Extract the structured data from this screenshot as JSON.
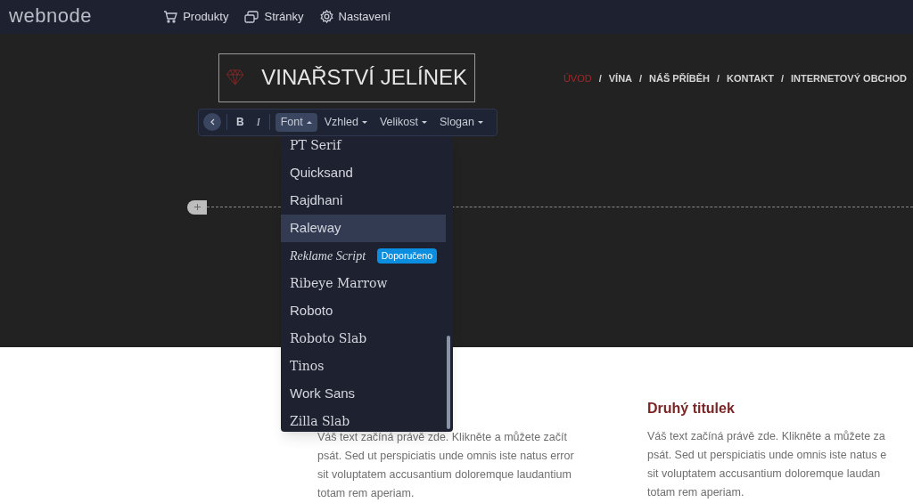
{
  "topbar": {
    "logo": "webnode",
    "menu": [
      {
        "label": "Produkty"
      },
      {
        "label": "Stránky"
      },
      {
        "label": "Nastavení"
      }
    ]
  },
  "site": {
    "logo_text": "VINAŘSTVÍ JELÍNEK",
    "nav": [
      {
        "label": "ÚVOD",
        "selected": true
      },
      {
        "label": "VÍNA",
        "selected": false
      },
      {
        "label": "NÁŠ PŘÍBĚH",
        "selected": false
      },
      {
        "label": "KONTAKT",
        "selected": false
      },
      {
        "label": "INTERNETOVÝ OBCHOD",
        "selected": false
      }
    ],
    "separator": "/"
  },
  "toolbar": {
    "bold": "B",
    "italic": "I",
    "menus": [
      {
        "label": "Font",
        "expanded": true
      },
      {
        "label": "Vzhled",
        "expanded": false
      },
      {
        "label": "Velikost",
        "expanded": false
      },
      {
        "label": "Slogan",
        "expanded": false
      }
    ]
  },
  "font_dropdown": {
    "items": [
      {
        "label": "PT Serif",
        "selected": false
      },
      {
        "label": "Quicksand",
        "selected": false
      },
      {
        "label": "Rajdhani",
        "selected": false
      },
      {
        "label": "Raleway",
        "selected": true
      },
      {
        "label": "Reklame Script",
        "selected": false,
        "badge": "Doporučeno"
      },
      {
        "label": "Ribeye Marrow",
        "selected": false
      },
      {
        "label": "Roboto",
        "selected": false
      },
      {
        "label": "Roboto Slab",
        "selected": false
      },
      {
        "label": "Tinos",
        "selected": false
      },
      {
        "label": "Work Sans",
        "selected": false
      },
      {
        "label": "Zilla Slab",
        "selected": false
      }
    ]
  },
  "content": {
    "columns": [
      {
        "lines": [
          "Váš text začíná právě zde. Klikněte a můžete začít",
          "psát. Sed ut perspiciatis unde omnis iste natus error",
          "sit voluptatem accusantium doloremque laudantium",
          "totam rem aperiam."
        ]
      },
      {
        "title": "Druhý titulek",
        "lines": [
          "Váš text začíná právě zde. Klikněte a můžete za",
          "psát. Sed ut perspiciatis unde omnis iste natus e",
          "sit voluptatem accusantium doloremque laudan",
          "totam rem aperiam."
        ]
      }
    ]
  }
}
